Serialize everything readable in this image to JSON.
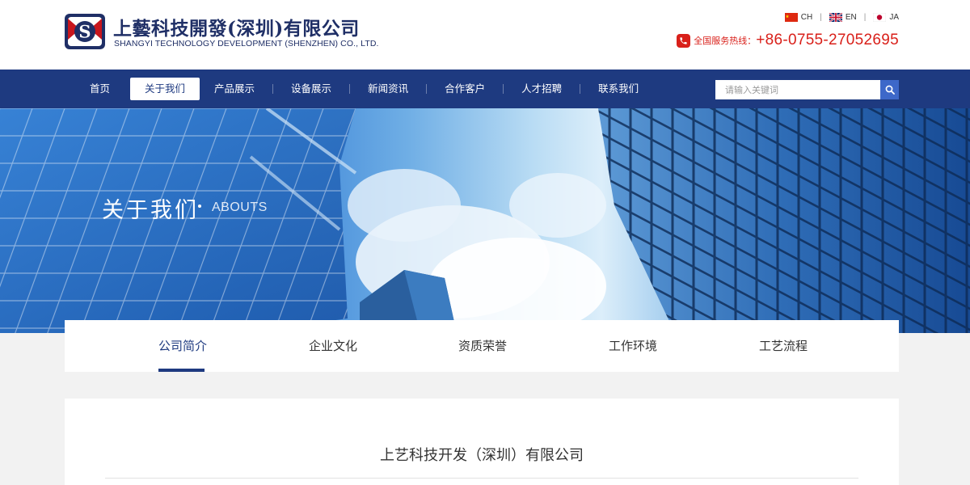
{
  "header": {
    "logo_cn": "上藝科技開發(深圳)有限公司",
    "logo_en": "SHANGYI TECHNOLOGY DEVELOPMENT (SHENZHEN) CO., LTD.",
    "logo_letter": "S",
    "languages": [
      {
        "code": "CH",
        "icon": "china-flag-icon"
      },
      {
        "code": "EN",
        "icon": "uk-flag-icon"
      },
      {
        "code": "JA",
        "icon": "japan-flag-icon"
      }
    ],
    "lang_separator": "|",
    "hotline_label": "全国服务热线：",
    "hotline_number": "+86-0755-27052695"
  },
  "nav": {
    "items": [
      "首页",
      "关于我们",
      "产品展示",
      "设备展示",
      "新闻资讯",
      "合作客户",
      "人才招聘",
      "联系我们"
    ],
    "active_index": 1,
    "search_placeholder": "请输入关键词"
  },
  "banner": {
    "title": "关于我们",
    "subtitle": "ABOUTS"
  },
  "subtabs": {
    "items": [
      "公司简介",
      "企业文化",
      "资质荣誉",
      "工作环境",
      "工艺流程"
    ],
    "active_index": 0
  },
  "content": {
    "title": "上艺科技开发（深圳）有限公司"
  },
  "colors": {
    "brand_navy": "#1e3a80",
    "hotline_red": "#d9201a",
    "search_button": "#3d68c9"
  }
}
